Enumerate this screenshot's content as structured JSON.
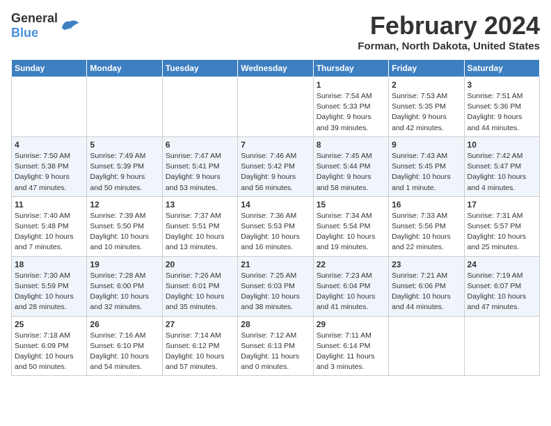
{
  "header": {
    "logo_line1": "General",
    "logo_line2": "Blue",
    "month_title": "February 2024",
    "location": "Forman, North Dakota, United States"
  },
  "weekdays": [
    "Sunday",
    "Monday",
    "Tuesday",
    "Wednesday",
    "Thursday",
    "Friday",
    "Saturday"
  ],
  "weeks": [
    [
      {
        "day": "",
        "info": ""
      },
      {
        "day": "",
        "info": ""
      },
      {
        "day": "",
        "info": ""
      },
      {
        "day": "",
        "info": ""
      },
      {
        "day": "1",
        "info": "Sunrise: 7:54 AM\nSunset: 5:33 PM\nDaylight: 9 hours\nand 39 minutes."
      },
      {
        "day": "2",
        "info": "Sunrise: 7:53 AM\nSunset: 5:35 PM\nDaylight: 9 hours\nand 42 minutes."
      },
      {
        "day": "3",
        "info": "Sunrise: 7:51 AM\nSunset: 5:36 PM\nDaylight: 9 hours\nand 44 minutes."
      }
    ],
    [
      {
        "day": "4",
        "info": "Sunrise: 7:50 AM\nSunset: 5:38 PM\nDaylight: 9 hours\nand 47 minutes."
      },
      {
        "day": "5",
        "info": "Sunrise: 7:49 AM\nSunset: 5:39 PM\nDaylight: 9 hours\nand 50 minutes."
      },
      {
        "day": "6",
        "info": "Sunrise: 7:47 AM\nSunset: 5:41 PM\nDaylight: 9 hours\nand 53 minutes."
      },
      {
        "day": "7",
        "info": "Sunrise: 7:46 AM\nSunset: 5:42 PM\nDaylight: 9 hours\nand 56 minutes."
      },
      {
        "day": "8",
        "info": "Sunrise: 7:45 AM\nSunset: 5:44 PM\nDaylight: 9 hours\nand 58 minutes."
      },
      {
        "day": "9",
        "info": "Sunrise: 7:43 AM\nSunset: 5:45 PM\nDaylight: 10 hours\nand 1 minute."
      },
      {
        "day": "10",
        "info": "Sunrise: 7:42 AM\nSunset: 5:47 PM\nDaylight: 10 hours\nand 4 minutes."
      }
    ],
    [
      {
        "day": "11",
        "info": "Sunrise: 7:40 AM\nSunset: 5:48 PM\nDaylight: 10 hours\nand 7 minutes."
      },
      {
        "day": "12",
        "info": "Sunrise: 7:39 AM\nSunset: 5:50 PM\nDaylight: 10 hours\nand 10 minutes."
      },
      {
        "day": "13",
        "info": "Sunrise: 7:37 AM\nSunset: 5:51 PM\nDaylight: 10 hours\nand 13 minutes."
      },
      {
        "day": "14",
        "info": "Sunrise: 7:36 AM\nSunset: 5:53 PM\nDaylight: 10 hours\nand 16 minutes."
      },
      {
        "day": "15",
        "info": "Sunrise: 7:34 AM\nSunset: 5:54 PM\nDaylight: 10 hours\nand 19 minutes."
      },
      {
        "day": "16",
        "info": "Sunrise: 7:33 AM\nSunset: 5:56 PM\nDaylight: 10 hours\nand 22 minutes."
      },
      {
        "day": "17",
        "info": "Sunrise: 7:31 AM\nSunset: 5:57 PM\nDaylight: 10 hours\nand 25 minutes."
      }
    ],
    [
      {
        "day": "18",
        "info": "Sunrise: 7:30 AM\nSunset: 5:59 PM\nDaylight: 10 hours\nand 28 minutes."
      },
      {
        "day": "19",
        "info": "Sunrise: 7:28 AM\nSunset: 6:00 PM\nDaylight: 10 hours\nand 32 minutes."
      },
      {
        "day": "20",
        "info": "Sunrise: 7:26 AM\nSunset: 6:01 PM\nDaylight: 10 hours\nand 35 minutes."
      },
      {
        "day": "21",
        "info": "Sunrise: 7:25 AM\nSunset: 6:03 PM\nDaylight: 10 hours\nand 38 minutes."
      },
      {
        "day": "22",
        "info": "Sunrise: 7:23 AM\nSunset: 6:04 PM\nDaylight: 10 hours\nand 41 minutes."
      },
      {
        "day": "23",
        "info": "Sunrise: 7:21 AM\nSunset: 6:06 PM\nDaylight: 10 hours\nand 44 minutes."
      },
      {
        "day": "24",
        "info": "Sunrise: 7:19 AM\nSunset: 6:07 PM\nDaylight: 10 hours\nand 47 minutes."
      }
    ],
    [
      {
        "day": "25",
        "info": "Sunrise: 7:18 AM\nSunset: 6:09 PM\nDaylight: 10 hours\nand 50 minutes."
      },
      {
        "day": "26",
        "info": "Sunrise: 7:16 AM\nSunset: 6:10 PM\nDaylight: 10 hours\nand 54 minutes."
      },
      {
        "day": "27",
        "info": "Sunrise: 7:14 AM\nSunset: 6:12 PM\nDaylight: 10 hours\nand 57 minutes."
      },
      {
        "day": "28",
        "info": "Sunrise: 7:12 AM\nSunset: 6:13 PM\nDaylight: 11 hours\nand 0 minutes."
      },
      {
        "day": "29",
        "info": "Sunrise: 7:11 AM\nSunset: 6:14 PM\nDaylight: 11 hours\nand 3 minutes."
      },
      {
        "day": "",
        "info": ""
      },
      {
        "day": "",
        "info": ""
      }
    ]
  ]
}
